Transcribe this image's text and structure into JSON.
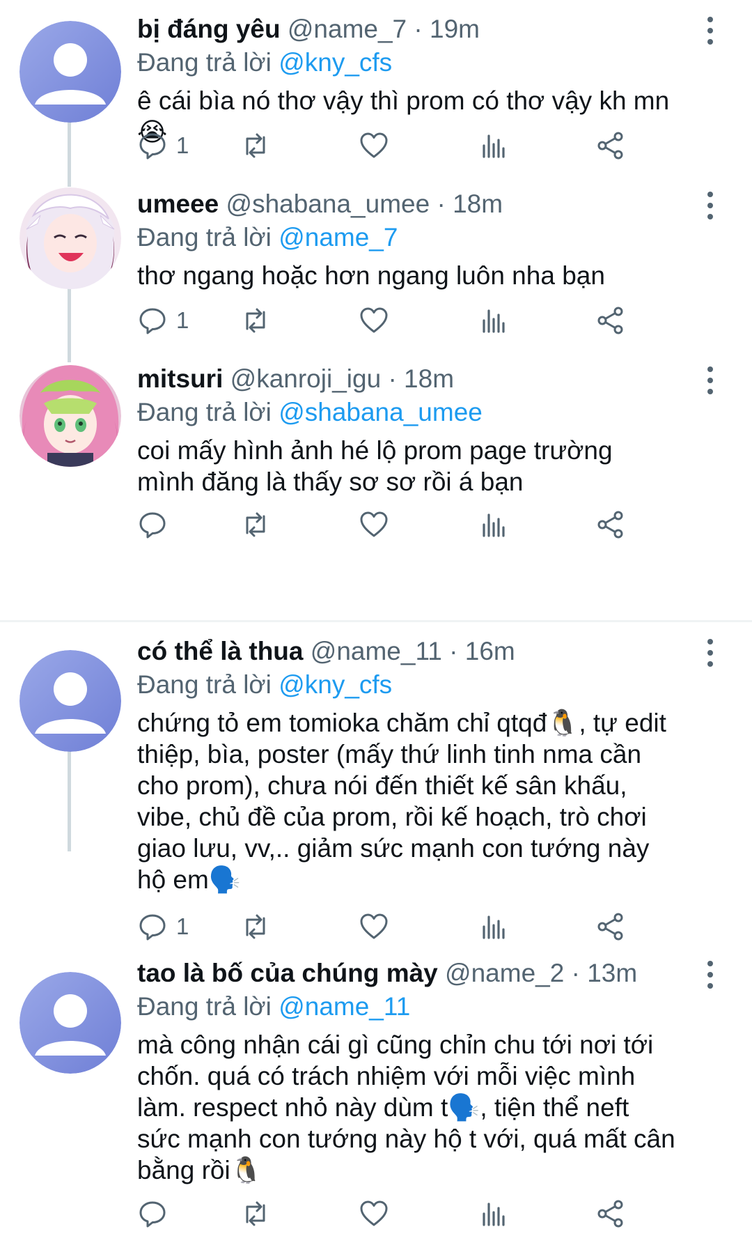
{
  "reply_prefix": "Đang trả lời",
  "colors": {
    "accent": "#1d9bf0",
    "muted": "#536471",
    "thread_line": "#cfd9de"
  },
  "tweets": [
    {
      "name": "bị đáng yêu",
      "handle": "@name_7",
      "time": "19m",
      "reply_to": "@kny_cfs",
      "text": "ê cái bìa nó thơ vậy thì prom có thơ vậy kh mn😭",
      "reply_count": "1",
      "avatar": "default-avatar"
    },
    {
      "name": "umeee",
      "handle": "@shabana_umee",
      "time": "18m",
      "reply_to": "@name_7",
      "text": "thơ ngang hoặc hơn ngang luôn nha bạn",
      "reply_count": "1",
      "avatar": "anime-white-hair-avatar"
    },
    {
      "name": "mitsuri",
      "handle": "@kanroji_igu",
      "time": "18m",
      "reply_to": "@shabana_umee",
      "text": "coi mấy hình ảnh hé lộ prom page trường mình đăng là thấy sơ sơ rồi á bạn",
      "reply_count": "",
      "avatar": "anime-pink-hair-avatar"
    },
    {
      "name": "có thể là thua",
      "handle": "@name_11",
      "time": "16m",
      "reply_to": "@kny_cfs",
      "text": "chứng tỏ em tomioka chăm chỉ qtqđ🐧, tự edit thiệp, bìa, poster (mấy thứ linh tinh nma cần cho prom), chưa nói đến thiết kế sân khấu, vibe, chủ đề của prom, rồi kế hoạch, trò chơi giao lưu, vv,.. giảm sức mạnh con tướng này hộ em🗣️",
      "reply_count": "1",
      "avatar": "default-avatar"
    },
    {
      "name": "tao là bố của chúng mày",
      "handle": "@name_2",
      "time": "13m",
      "reply_to": "@name_11",
      "text": "mà công nhận cái gì cũng chỉn chu tới nơi tới chốn. quá có trách nhiệm với mỗi việc mình làm. respect nhỏ này dùm t🗣️, tiện thể neft sức mạnh con tướng này hộ t với, quá mất cân bằng rồi🐧",
      "reply_count": "",
      "avatar": "default-avatar"
    }
  ]
}
